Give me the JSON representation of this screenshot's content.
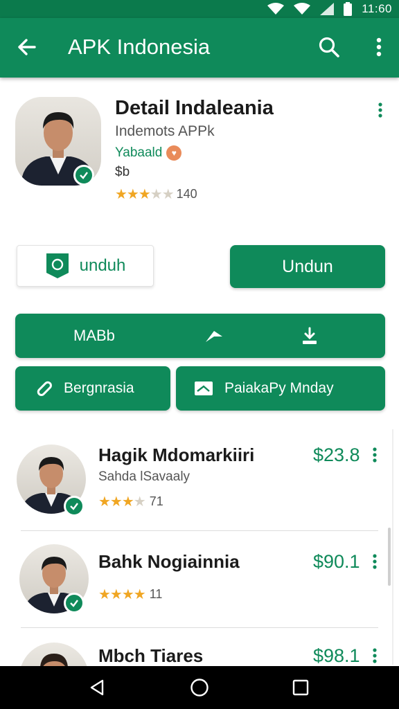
{
  "status_bar": {
    "time": "11:60",
    "icons": [
      "wifi-icon",
      "wifi-icon",
      "signal-icon",
      "battery-icon"
    ]
  },
  "app_bar": {
    "title": "APK Indonesia",
    "icons": [
      "back-arrow-icon",
      "search-icon",
      "more-vert-icon"
    ]
  },
  "app_detail": {
    "title": "Detail Indaleania",
    "subtitle": "Indemots APPk",
    "developer": "Yabaald",
    "price": "$b",
    "rating_stars": 3.5,
    "rating_count": "140"
  },
  "actions": {
    "outline_button": "unduh",
    "primary_button": "Undun",
    "toolbar_label": "MABb",
    "left_button": "Bergnrasia",
    "right_button": "PaiakaPy Mnday"
  },
  "list": [
    {
      "name": "Hagik Mdomarkiiri",
      "subtitle": "Sahda lSavaaly",
      "rating_stars": 3.5,
      "rating_count": "71",
      "price": "$23.8"
    },
    {
      "name": "Bahk Nogiainnia",
      "subtitle": "",
      "rating_stars": 4.5,
      "rating_count": "11",
      "price": "$90.1"
    },
    {
      "name": "Mbch Tiares",
      "subtitle": "",
      "rating_stars": 0,
      "rating_count": "",
      "price": "$98.1"
    }
  ],
  "colors": {
    "primary": "#0f8a5a",
    "status_bar": "#0b7a4c",
    "star": "#f0a623",
    "text": "#1b1b1b"
  },
  "nav_bar": {
    "icons": [
      "back-triangle-icon",
      "home-circle-icon",
      "recents-square-icon"
    ]
  }
}
